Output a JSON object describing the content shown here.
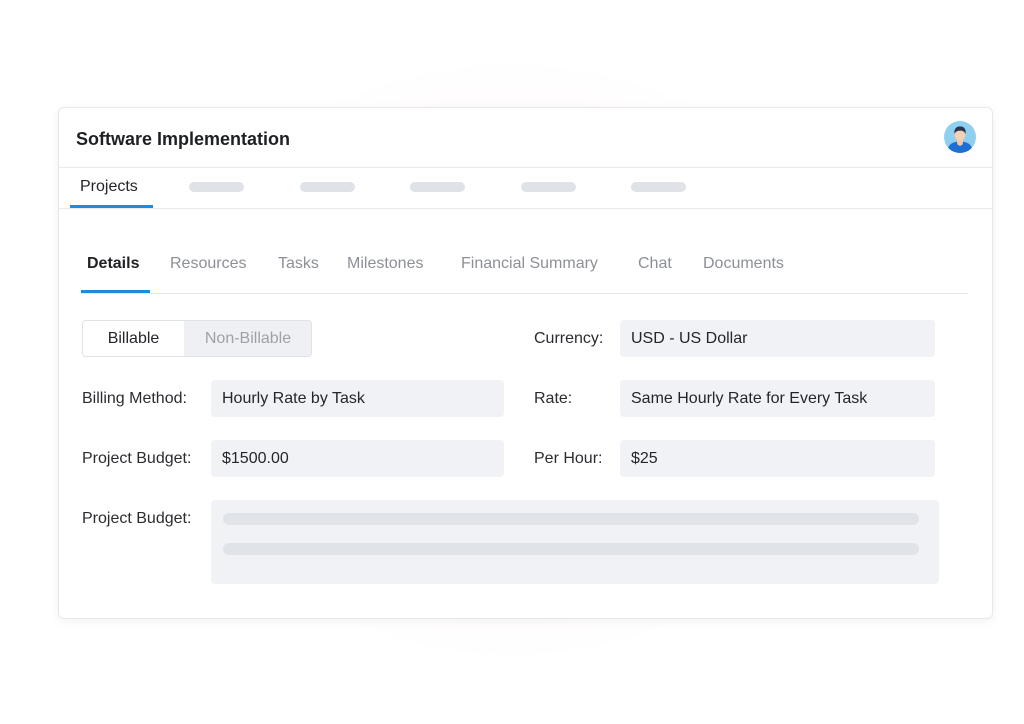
{
  "card": {
    "title": "Software Implementation"
  },
  "topnav": {
    "active_label": "Projects"
  },
  "subtabs": [
    {
      "label": "Details",
      "active": true
    },
    {
      "label": "Resources",
      "active": false
    },
    {
      "label": "Tasks",
      "active": false
    },
    {
      "label": "Milestones",
      "active": false
    },
    {
      "label": "Financial Summary",
      "active": false
    },
    {
      "label": "Chat",
      "active": false
    },
    {
      "label": "Documents",
      "active": false
    }
  ],
  "billing_toggle": {
    "options": [
      "Billable",
      "Non-Billable"
    ],
    "selected": "Billable"
  },
  "form": {
    "currency_label": "Currency:",
    "currency_value": "USD - US Dollar",
    "billing_method_label": "Billing Method:",
    "billing_method_value": "Hourly Rate by Task",
    "rate_label": "Rate:",
    "rate_value": "Same Hourly Rate for Every Task",
    "project_budget_label": "Project Budget:",
    "project_budget_value": "$1500.00",
    "per_hour_label": "Per Hour:",
    "per_hour_value": "$25",
    "project_budget_notes_label": "Project Budget:"
  },
  "colors": {
    "accent": "#1c8be0",
    "field_bg": "#f0f2f5",
    "muted_text": "#8c9096"
  },
  "icons": {
    "avatar": "user-avatar-icon"
  }
}
